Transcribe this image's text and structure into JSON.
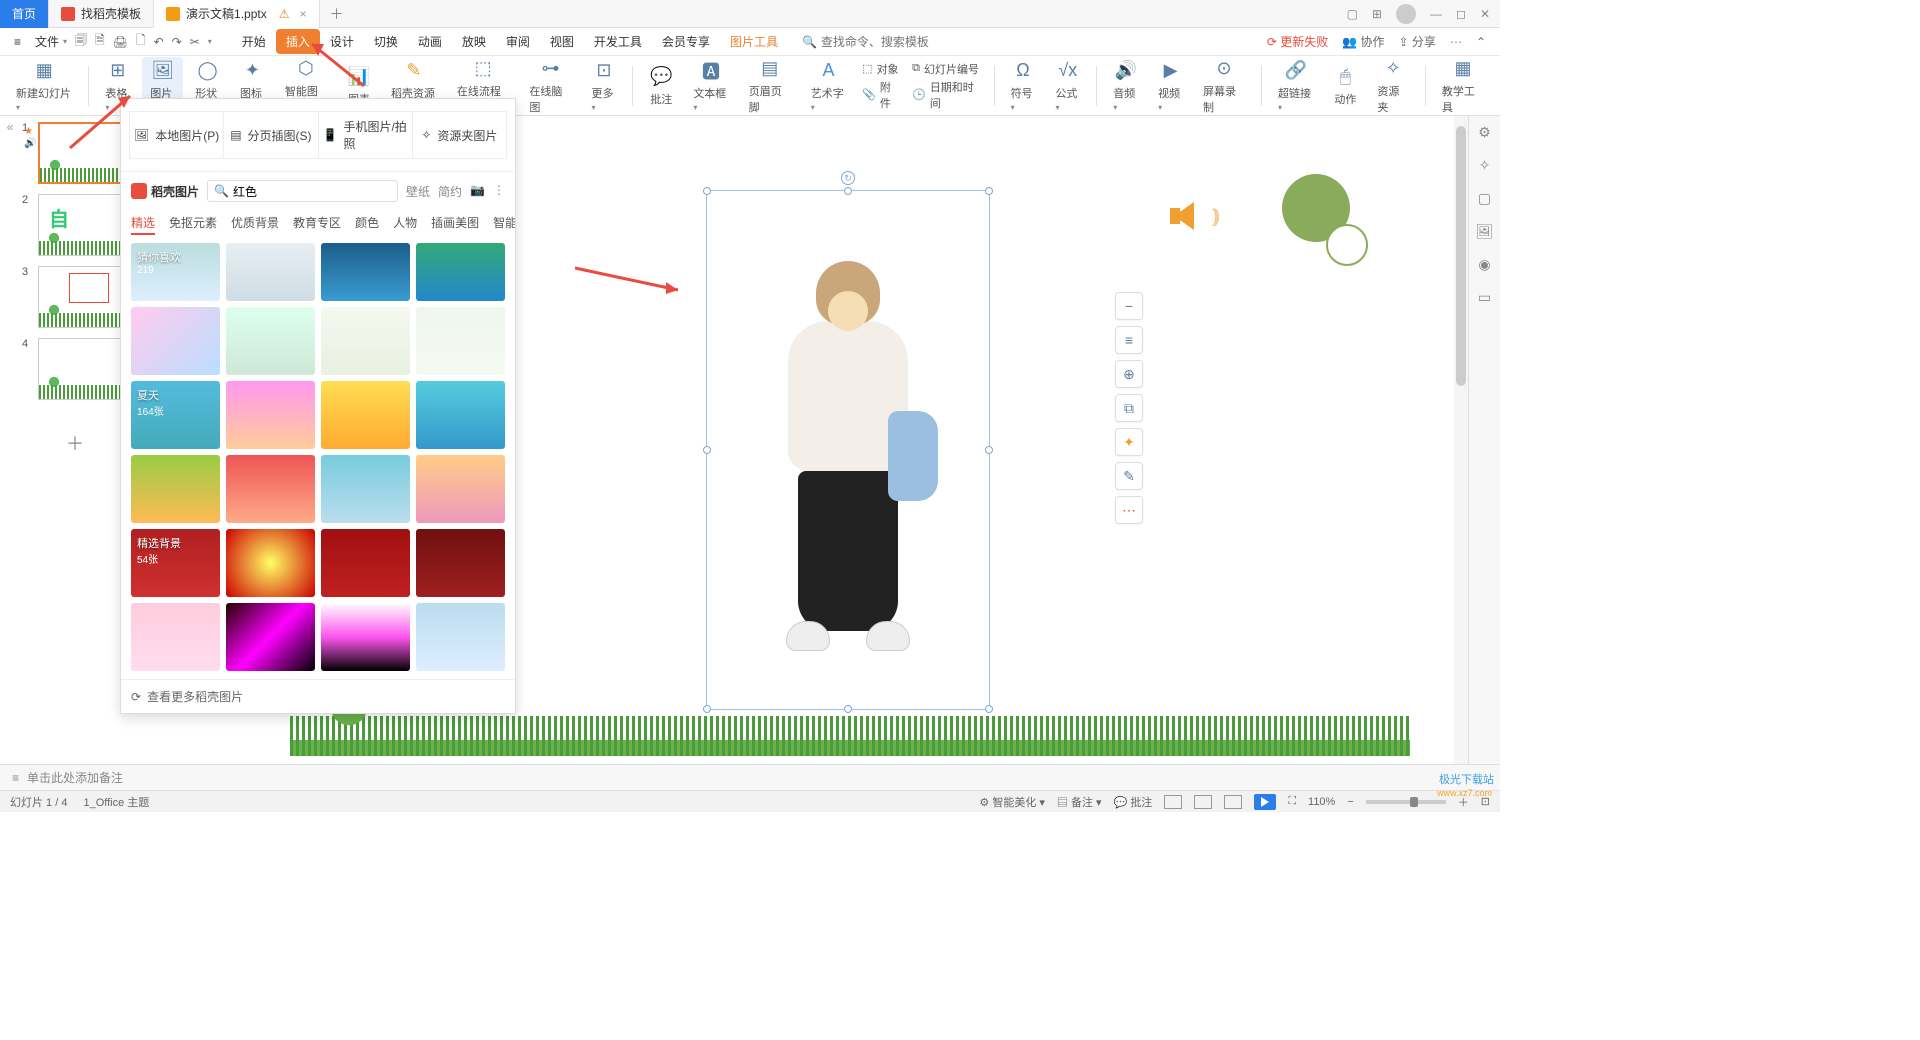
{
  "titlebar": {
    "home": "首页",
    "tab1": "找稻壳模板",
    "tab2": "演示文稿1.pptx"
  },
  "menubar": {
    "file": "文件",
    "tabs": [
      "开始",
      "插入",
      "设计",
      "切换",
      "动画",
      "放映",
      "审阅",
      "视图",
      "开发工具",
      "会员专享",
      "图片工具"
    ],
    "search_placeholder": "查找命令、搜索模板",
    "update_fail": "更新失败",
    "coop": "协作",
    "share": "分享"
  },
  "ribbon": {
    "items": [
      "新建幻灯片",
      "表格",
      "图片",
      "形状",
      "图标",
      "智能图形",
      "图表",
      "稻壳资源",
      "在线流程图",
      "在线脑图",
      "更多",
      "批注",
      "文本框",
      "页眉页脚",
      "艺术字",
      "符号",
      "公式",
      "音频",
      "视频",
      "屏幕录制",
      "超链接",
      "动作",
      "资源夹",
      "教学工具"
    ],
    "attach_object": "对象",
    "attach_slidenum": "幻灯片编号",
    "attach_file": "附件",
    "attach_datetime": "日期和时间"
  },
  "img_panel": {
    "opts": [
      "本地图片(P)",
      "分页插图(S)",
      "手机图片/拍照",
      "资源夹图片"
    ],
    "brand": "稻壳图片",
    "search_value": "红色",
    "chips": [
      "壁纸",
      "简约"
    ],
    "cats": [
      "精选",
      "免抠元素",
      "优质背景",
      "教育专区",
      "颜色",
      "人物",
      "插画美图",
      "智能"
    ],
    "tile_like": "猜你喜欢",
    "tile_like_sub": "219",
    "tile_summer": "夏天",
    "tile_summer_sub": "164张",
    "tile_bg": "精选背景",
    "tile_bg_sub": "54张",
    "more": "查看更多稻壳图片"
  },
  "slides": {
    "nums": [
      "1",
      "2",
      "3",
      "4"
    ],
    "slide2_text": "自"
  },
  "float_tb": {
    "items": [
      "−",
      "≡",
      "⊕",
      "⊡",
      "◧",
      "✎",
      "⋯"
    ]
  },
  "notes": "单击此处添加备注",
  "status": {
    "slide": "幻灯片 1 / 4",
    "theme": "1_Office 主题",
    "beautify": "智能美化",
    "note": "备注",
    "annotate": "批注",
    "zoom": "110%"
  },
  "watermark": {
    "name": "极光下载站",
    "url": "www.xz7.com"
  }
}
